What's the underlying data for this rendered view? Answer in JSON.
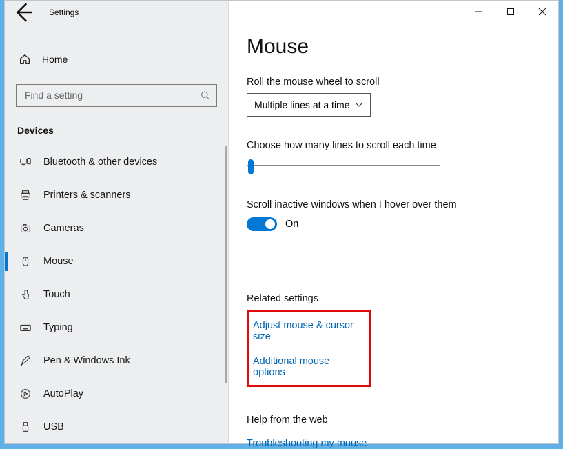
{
  "window": {
    "title": "Settings"
  },
  "sidebar": {
    "home": "Home",
    "search_placeholder": "Find a setting",
    "section": "Devices",
    "items": [
      {
        "label": "Bluetooth & other devices"
      },
      {
        "label": "Printers & scanners"
      },
      {
        "label": "Cameras"
      },
      {
        "label": "Mouse"
      },
      {
        "label": "Touch"
      },
      {
        "label": "Typing"
      },
      {
        "label": "Pen & Windows Ink"
      },
      {
        "label": "AutoPlay"
      },
      {
        "label": "USB"
      }
    ]
  },
  "main": {
    "title": "Mouse",
    "scroll_label": "Roll the mouse wheel to scroll",
    "scroll_combo": "Multiple lines at a time",
    "lines_label": "Choose how many lines to scroll each time",
    "inactive_label": "Scroll inactive windows when I hover over them",
    "toggle_value": "On",
    "related_head": "Related settings",
    "link_adjust": "Adjust mouse & cursor size",
    "link_additional": "Additional mouse options",
    "help_head": "Help from the web",
    "link_help": "Troubleshooting my mouse"
  }
}
